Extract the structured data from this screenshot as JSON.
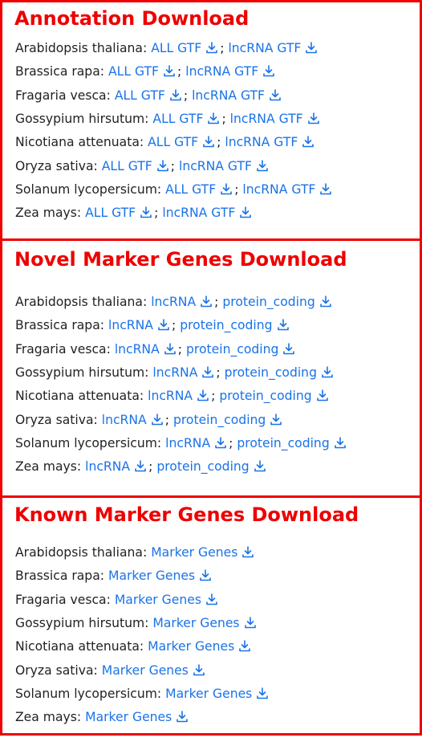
{
  "sections": [
    {
      "title": "Annotation Download",
      "rows": [
        {
          "species": "Arabidopsis thaliana:",
          "links": [
            "ALL GTF",
            "lncRNA GTF"
          ]
        },
        {
          "species": "Brassica rapa:",
          "links": [
            "ALL GTF",
            "lncRNA GTF"
          ]
        },
        {
          "species": "Fragaria vesca:",
          "links": [
            "ALL GTF",
            "lncRNA GTF"
          ]
        },
        {
          "species": "Gossypium hirsutum:",
          "links": [
            "ALL GTF",
            "lncRNA GTF"
          ]
        },
        {
          "species": "Nicotiana attenuata:",
          "links": [
            "ALL GTF",
            "lncRNA GTF"
          ]
        },
        {
          "species": "Oryza sativa:",
          "links": [
            "ALL GTF",
            "lncRNA GTF"
          ]
        },
        {
          "species": "Solanum lycopersicum:",
          "links": [
            "ALL GTF",
            "lncRNA GTF"
          ]
        },
        {
          "species": "Zea mays:",
          "links": [
            "ALL GTF",
            "lncRNA GTF"
          ]
        }
      ]
    },
    {
      "title": "Novel Marker Genes Download",
      "rows": [
        {
          "species": "Arabidopsis thaliana:",
          "links": [
            "lncRNA",
            "protein_coding"
          ]
        },
        {
          "species": "Brassica rapa:",
          "links": [
            "lncRNA",
            "protein_coding"
          ]
        },
        {
          "species": "Fragaria vesca:",
          "links": [
            "lncRNA",
            "protein_coding"
          ]
        },
        {
          "species": "Gossypium hirsutum:",
          "links": [
            "lncRNA",
            "protein_coding"
          ]
        },
        {
          "species": "Nicotiana attenuata:",
          "links": [
            "lncRNA",
            "protein_coding"
          ]
        },
        {
          "species": "Oryza sativa:",
          "links": [
            "lncRNA",
            "protein_coding"
          ]
        },
        {
          "species": "Solanum lycopersicum:",
          "links": [
            "lncRNA",
            "protein_coding"
          ]
        },
        {
          "species": "Zea mays:",
          "links": [
            "lncRNA",
            "protein_coding"
          ]
        }
      ]
    },
    {
      "title": "Known Marker Genes Download",
      "rows": [
        {
          "species": "Arabidopsis thaliana:",
          "links": [
            "Marker Genes"
          ]
        },
        {
          "species": "Brassica rapa:",
          "links": [
            "Marker Genes"
          ]
        },
        {
          "species": "Fragaria vesca:",
          "links": [
            "Marker Genes"
          ]
        },
        {
          "species": "Gossypium hirsutum:",
          "links": [
            "Marker Genes"
          ]
        },
        {
          "species": "Nicotiana attenuata:",
          "links": [
            "Marker Genes"
          ]
        },
        {
          "species": "Oryza sativa:",
          "links": [
            "Marker Genes"
          ]
        },
        {
          "species": "Solanum lycopersicum:",
          "links": [
            "Marker Genes"
          ]
        },
        {
          "species": "Zea mays:",
          "links": [
            "Marker Genes"
          ]
        }
      ]
    }
  ],
  "separator": ";",
  "icon": "download-icon",
  "colors": {
    "border": "#f00000",
    "title": "#ee0000",
    "link": "#1a73e8",
    "text": "#222222"
  }
}
